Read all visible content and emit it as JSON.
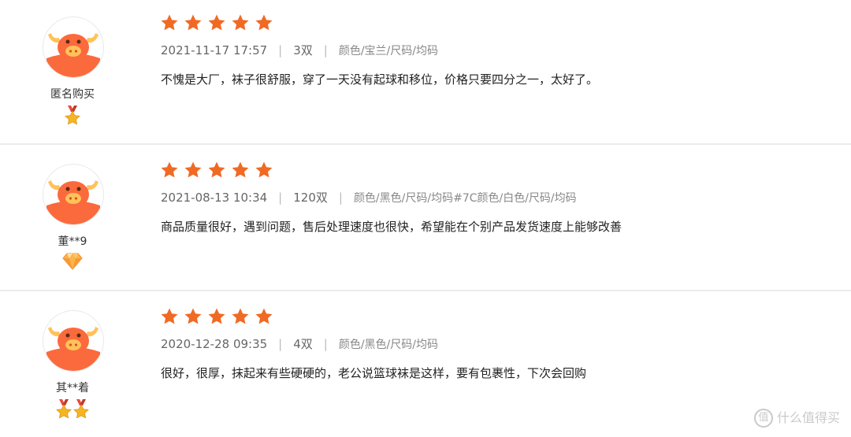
{
  "colors": {
    "star": "#f06a24",
    "avatar_face": "#fb6a3c",
    "avatar_horns": "#ffc25a",
    "divider": "#ebebeb"
  },
  "reviews": [
    {
      "username": "匿名购买",
      "level_badge_icon": "gold-medal-icon",
      "rating": 5,
      "date": "2021-11-17 17:57",
      "quantity": "3双",
      "spec": "颜色/宝兰/尺码/均码",
      "content": "不愧是大厂，袜子很舒服，穿了一天没有起球和移位，价格只要四分之一，太好了。"
    },
    {
      "username": "董**9",
      "level_badge_icon": "diamond-icon",
      "rating": 5,
      "date": "2021-08-13 10:34",
      "quantity": "120双",
      "spec": "颜色/黑色/尺码/均码#7C颜色/白色/尺码/均码",
      "content": "商品质量很好，遇到问题，售后处理速度也很快，希望能在个别产品发货速度上能够改善"
    },
    {
      "username": "其**着",
      "level_badge_icon": "double-gold-medal-icon",
      "rating": 5,
      "date": "2020-12-28 09:35",
      "quantity": "4双",
      "spec": "颜色/黑色/尺码/均码",
      "content": "很好，很厚，抹起来有些硬硬的，老公说篮球袜是这样，要有包裹性，下次会回购"
    }
  ],
  "separator": "|",
  "watermark": {
    "icon_text": "值",
    "text": "什么值得买"
  }
}
